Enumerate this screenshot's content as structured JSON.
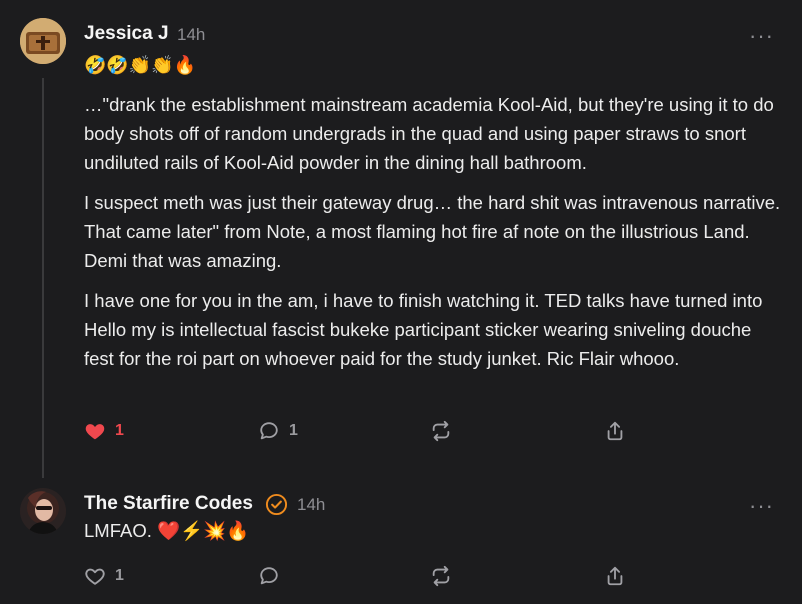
{
  "post": {
    "author": "Jessica J",
    "time": "14h",
    "reactions": "🤣🤣👏👏🔥",
    "paragraphs": [
      "…\"drank the establishment mainstream academia Kool-Aid, but they're using it to do body shots off of random undergrads in the quad and using paper straws to snort undiluted rails of Kool-Aid powder in the dining hall bathroom.",
      "I suspect meth was just their gateway drug… the hard shit was intravenous narrative. That came later\" from Note, a most flaming hot fire af note on the illustrious Land. Demi that was amazing.",
      "I have one for you in the am, i have to finish watching it. TED talks have turned into Hello my is intellectual fascist bukeke participant sticker wearing sniveling douche fest for the roi part on whoever paid for the study junket. Ric Flair whooo."
    ],
    "like_count": "1",
    "comment_count": "1",
    "more_label": "···"
  },
  "reply": {
    "author": "The Starfire Codes",
    "time": "14h",
    "text": "LMFAO. ❤️⚡💥🔥",
    "like_count": "1",
    "more_label": "···"
  },
  "colors": {
    "background": "#1c1c1e",
    "liked": "#f0484e",
    "verified": "#f08c1e",
    "muted": "#8e8e93"
  }
}
